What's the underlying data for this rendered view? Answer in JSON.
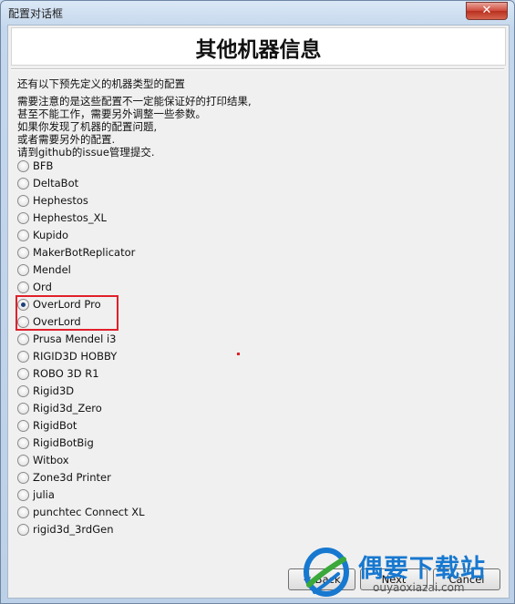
{
  "window": {
    "title": "配置对话框",
    "close_glyph": "✕"
  },
  "header": {
    "title": "其他机器信息"
  },
  "description": {
    "lines": [
      "还有以下预先定义的机器类型的配置",
      "需要注意的是这些配置不一定能保证好的打印结果,",
      "甚至不能工作，需要另外调整一些参数。",
      "如果你发现了机器的配置问题,",
      "或者需要另外的配置.",
      "请到github的issue管理提交."
    ]
  },
  "machines": {
    "selected": "OverLord Pro",
    "items": [
      {
        "label": "BFB",
        "checked": false
      },
      {
        "label": "DeltaBot",
        "checked": false
      },
      {
        "label": "Hephestos",
        "checked": false
      },
      {
        "label": "Hephestos_XL",
        "checked": false
      },
      {
        "label": "Kupido",
        "checked": false
      },
      {
        "label": "MakerBotReplicator",
        "checked": false
      },
      {
        "label": "Mendel",
        "checked": false
      },
      {
        "label": "Ord",
        "checked": false
      },
      {
        "label": "OverLord Pro",
        "checked": true
      },
      {
        "label": "OverLord",
        "checked": false
      },
      {
        "label": "Prusa Mendel i3",
        "checked": false
      },
      {
        "label": "RIGID3D HOBBY",
        "checked": false
      },
      {
        "label": "ROBO 3D R1",
        "checked": false
      },
      {
        "label": "Rigid3D",
        "checked": false
      },
      {
        "label": "Rigid3d_Zero",
        "checked": false
      },
      {
        "label": "RigidBot",
        "checked": false
      },
      {
        "label": "RigidBotBig",
        "checked": false
      },
      {
        "label": "Witbox",
        "checked": false
      },
      {
        "label": "Zone3d Printer",
        "checked": false
      },
      {
        "label": "julia",
        "checked": false
      },
      {
        "label": "punchtec Connect XL",
        "checked": false
      },
      {
        "label": "rigid3d_3rdGen",
        "checked": false
      }
    ]
  },
  "buttons": {
    "back": "< Back",
    "next": "Next",
    "cancel": "Cancel"
  },
  "watermark": {
    "title": "偶要下载站",
    "domain": "ouyaoxiazai.com"
  },
  "colors": {
    "highlight": "#e0202a",
    "watermark_blue": "#1778cf",
    "watermark_green": "#3aa83a"
  }
}
